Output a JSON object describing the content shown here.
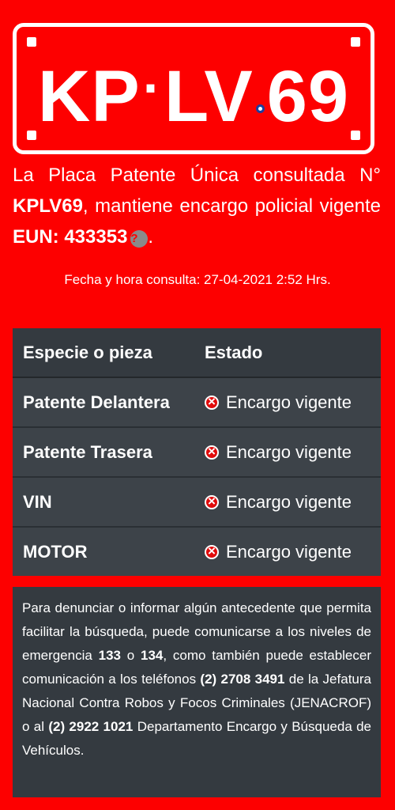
{
  "plate": {
    "part1": "KP",
    "separator": "·",
    "part2": "LV",
    "part3": "69",
    "emblem_icon": "chile-star-emblem-icon"
  },
  "summary": {
    "prefix": "La Placa Patente Única consultada N° ",
    "plate_number": "KPLV69",
    "middle": ", mantiene encargo policial vigente ",
    "eun_label": "EUN: 433353",
    "help_icon_glyph": "?",
    "suffix": "."
  },
  "query_date": "Fecha y hora consulta: 27-04-2021 2:52 Hrs.",
  "table": {
    "headers": [
      "Especie o pieza",
      "Estado"
    ],
    "rows": [
      {
        "piece": "Patente Delantera",
        "status": "Encargo vigente"
      },
      {
        "piece": "Patente Trasera",
        "status": "Encargo vigente"
      },
      {
        "piece": "VIN",
        "status": "Encargo vigente"
      },
      {
        "piece": "MOTOR",
        "status": "Encargo vigente"
      }
    ]
  },
  "info": {
    "t1": "Para denunciar o informar algún antecedente que permita facilitar la búsqueda, puede comunicarse a los niveles de emergencia ",
    "n1": "133",
    "t2": " o ",
    "n2": "134",
    "t3": ", como también puede establecer comunicación a los teléfonos ",
    "p1": "(2) 2708 3491",
    "t4": " de la Jefatura Nacional Contra Robos y Focos Criminales (JENACROF) o al ",
    "p2": "(2) 2922 1021",
    "t5": " Departamento Encargo y Búsqueda de Vehículos."
  },
  "colors": {
    "background": "#fd0000",
    "panel": "#343a40",
    "status_icon": "#e10b0b"
  }
}
